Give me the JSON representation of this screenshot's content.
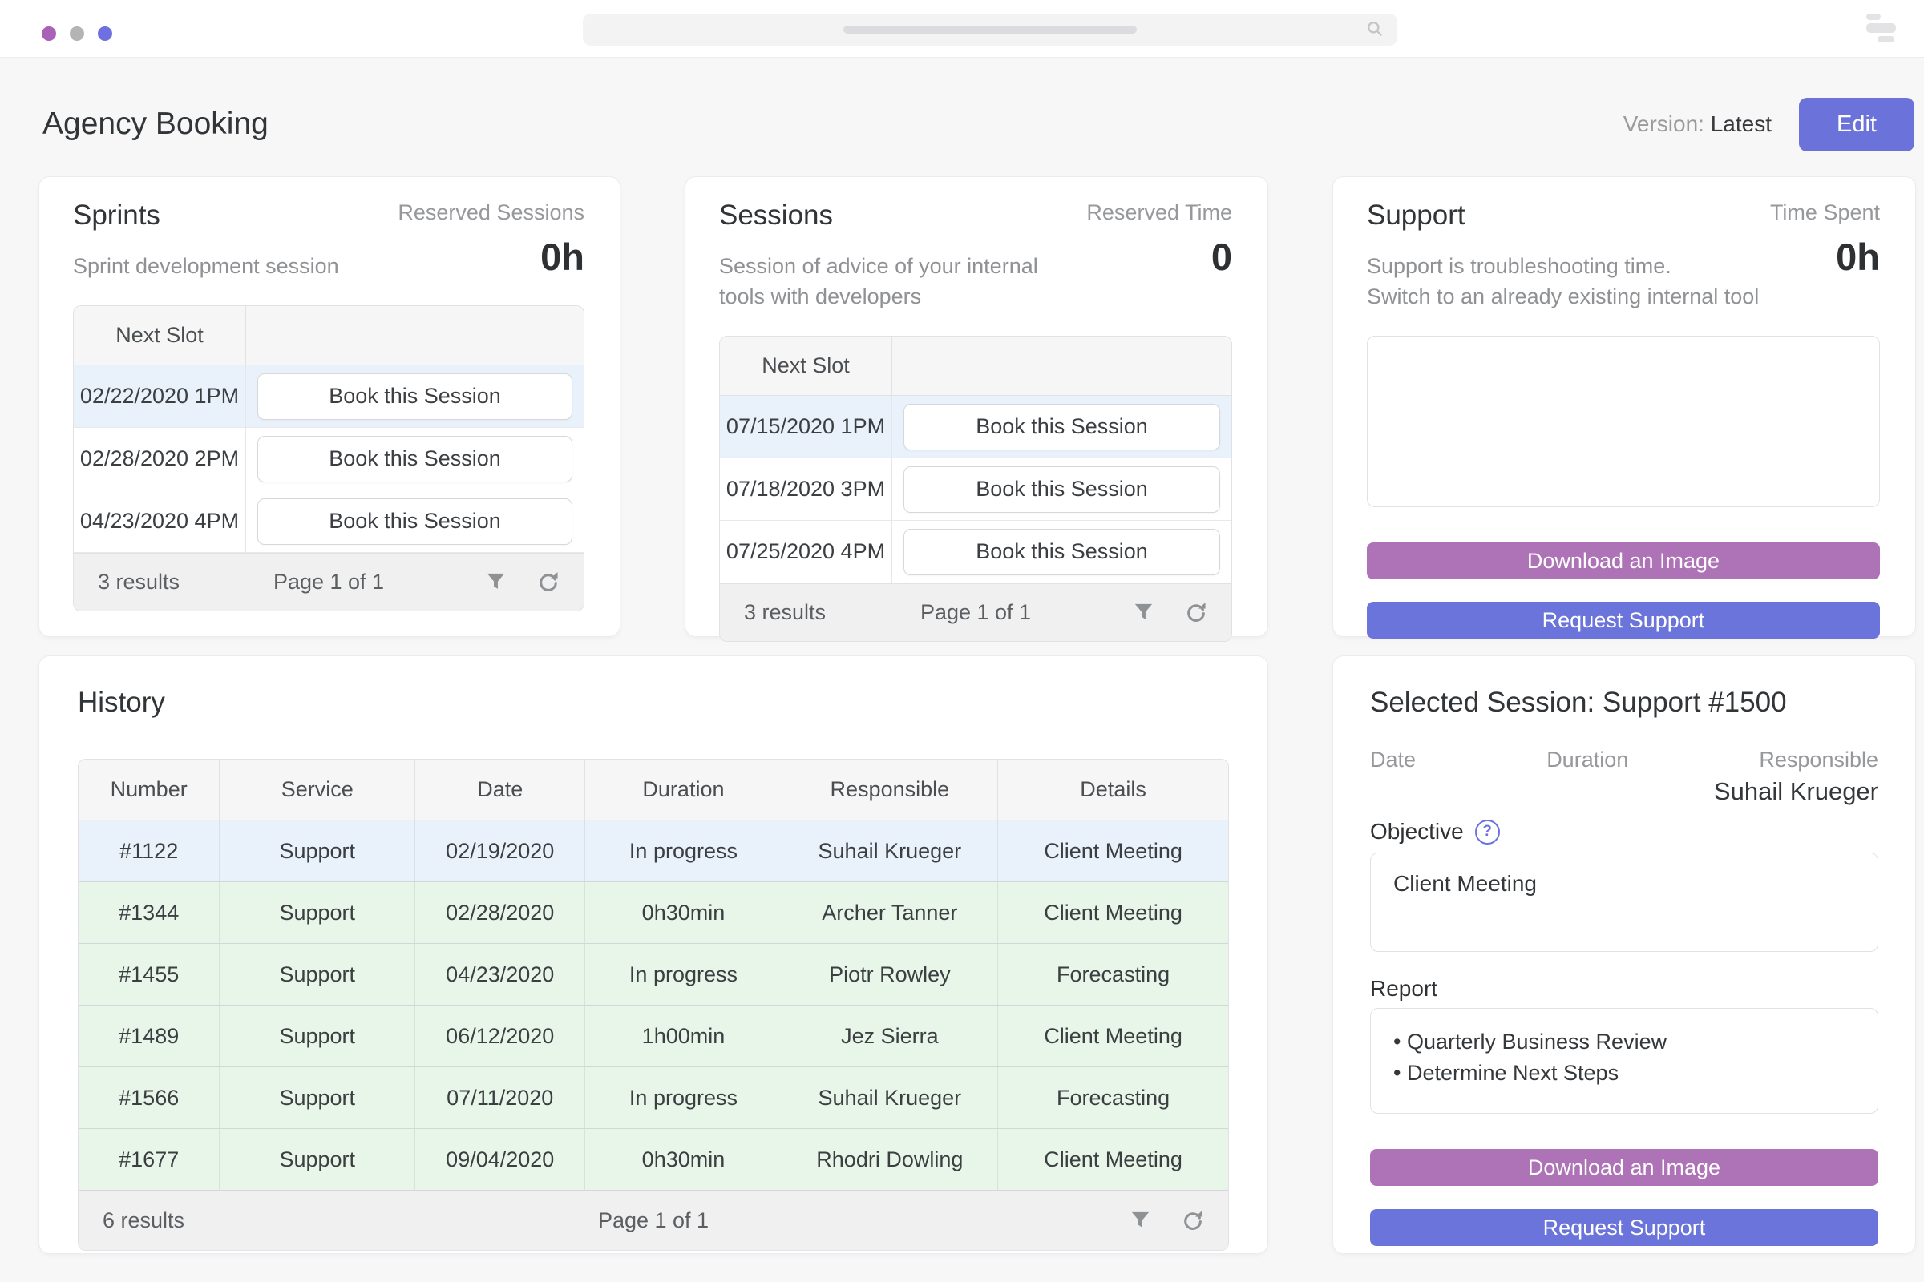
{
  "topbar": {
    "window_dots": [
      "purple",
      "gray",
      "indigo"
    ],
    "search": {
      "value": "",
      "placeholder": ""
    }
  },
  "header": {
    "title": "Agency Booking",
    "version_label": "Version:",
    "version_value": "Latest",
    "edit_button": "Edit"
  },
  "colors": {
    "accent_indigo": "#6b72d9",
    "accent_purple": "#ad73b6",
    "row_highlight_blue": "#e9f1fb",
    "row_green": "#e7f6e8",
    "page_background": "#f7f7f8"
  },
  "icons": {
    "search": "magnifier",
    "filter": "funnel",
    "refresh": "circular-arrow",
    "help": "question-mark-circle",
    "question_glyph": "?"
  },
  "sprints": {
    "title": "Sprints",
    "subtitle": "Sprint development session",
    "metric_label": "Reserved Sessions",
    "metric_value": "0h",
    "table": {
      "header": "Next Slot",
      "rows": [
        {
          "slot": "02/22/2020 1PM",
          "action": "Book this Session"
        },
        {
          "slot": "02/28/2020 2PM",
          "action": "Book this Session"
        },
        {
          "slot": "04/23/2020 4PM",
          "action": "Book this Session"
        }
      ],
      "footer": {
        "results": "3 results",
        "page": "Page 1 of 1"
      }
    }
  },
  "sessions": {
    "title": "Sessions",
    "subtitle": "Session of advice of your internal tools with developers",
    "metric_label": "Reserved Time",
    "metric_value": "0",
    "table": {
      "header": "Next Slot",
      "rows": [
        {
          "slot": "07/15/2020 1PM",
          "action": "Book this Session"
        },
        {
          "slot": "07/18/2020 3PM",
          "action": "Book this Session"
        },
        {
          "slot": "07/25/2020 4PM",
          "action": "Book this Session"
        }
      ],
      "footer": {
        "results": "3 results",
        "page": "Page 1 of 1"
      }
    }
  },
  "support": {
    "title": "Support",
    "subtitle_line1": "Support is troubleshooting time.",
    "subtitle_line2": "Switch to an already existing internal tool",
    "metric_label": "Time Spent",
    "metric_value": "0h",
    "download_button": "Download an Image",
    "request_button": "Request Support"
  },
  "history": {
    "title": "History",
    "columns": [
      "Number",
      "Service",
      "Date",
      "Duration",
      "Responsible",
      "Details"
    ],
    "rows": [
      {
        "number": "#1122",
        "service": "Support",
        "date": "02/19/2020",
        "duration": "In progress",
        "responsible": "Suhail Krueger",
        "details": "Client Meeting",
        "highlight": "blue"
      },
      {
        "number": "#1344",
        "service": "Support",
        "date": "02/28/2020",
        "duration": "0h30min",
        "responsible": "Archer Tanner",
        "details": "Client Meeting",
        "highlight": "green"
      },
      {
        "number": "#1455",
        "service": "Support",
        "date": "04/23/2020",
        "duration": "In progress",
        "responsible": "Piotr Rowley",
        "details": "Forecasting",
        "highlight": "green"
      },
      {
        "number": "#1489",
        "service": "Support",
        "date": "06/12/2020",
        "duration": "1h00min",
        "responsible": "Jez Sierra",
        "details": "Client Meeting",
        "highlight": "green"
      },
      {
        "number": "#1566",
        "service": "Support",
        "date": "07/11/2020",
        "duration": "In progress",
        "responsible": "Suhail Krueger",
        "details": "Forecasting",
        "highlight": "green"
      },
      {
        "number": "#1677",
        "service": "Support",
        "date": "09/04/2020",
        "duration": "0h30min",
        "responsible": "Rhodri Dowling",
        "details": "Client Meeting",
        "highlight": "green"
      }
    ],
    "footer": {
      "results": "6 results",
      "page": "Page 1 of 1"
    }
  },
  "selected_session": {
    "title": "Selected Session: Support #1500",
    "date_label": "Date",
    "duration_label": "Duration",
    "responsible_label": "Responsible",
    "date_value": "",
    "duration_value": "",
    "responsible_value": "Suhail Krueger",
    "objective_label": "Objective",
    "objective_value": "Client Meeting",
    "report_label": "Report",
    "report_items": [
      "Quarterly Business Review",
      "Determine Next Steps"
    ],
    "download_button": "Download an Image",
    "request_button": "Request Support"
  }
}
